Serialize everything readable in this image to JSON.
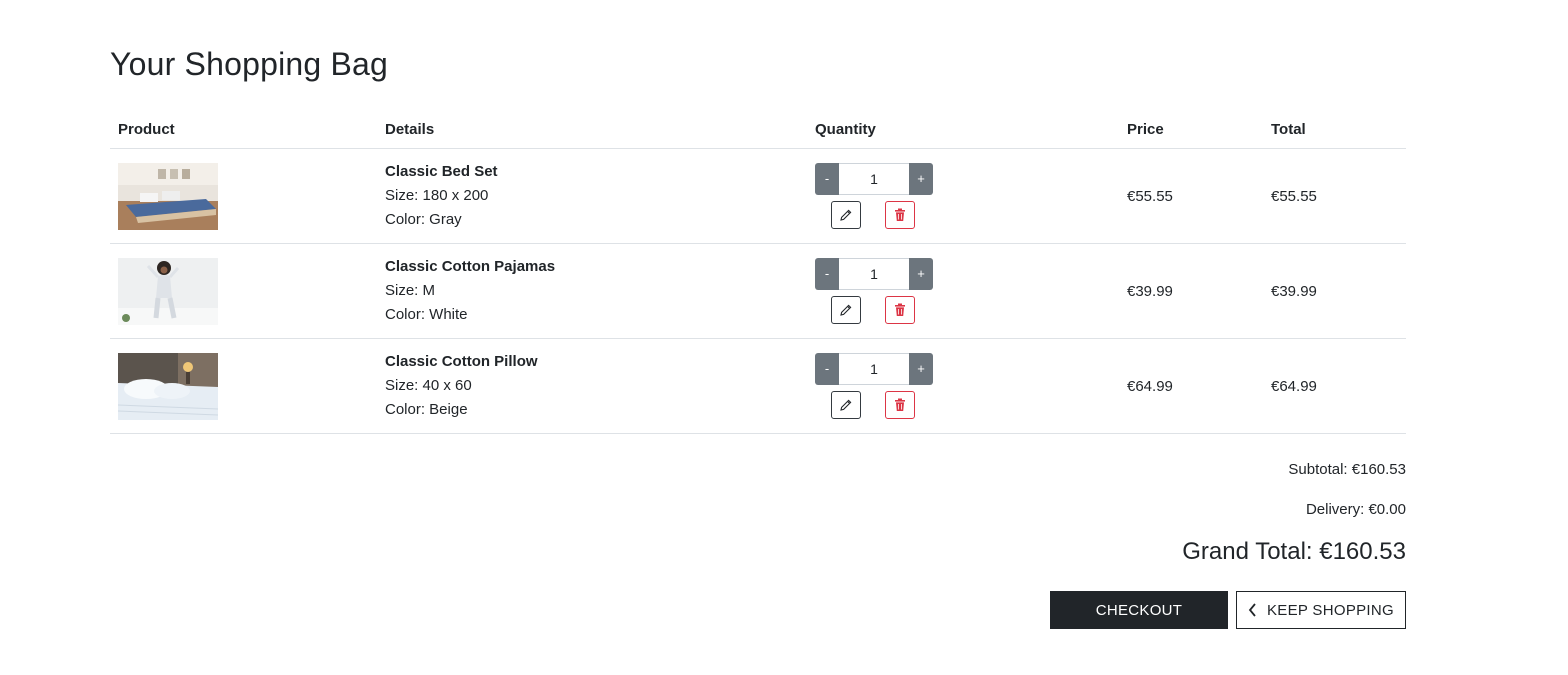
{
  "page": {
    "title": "Your Shopping Bag"
  },
  "table": {
    "headers": [
      "Product",
      "Details",
      "Quantity",
      "Price",
      "Total"
    ]
  },
  "items": [
    {
      "name": "Classic Bed Set",
      "size": "Size: 180 x 200",
      "color": "Color: Gray",
      "qty_minus": "-",
      "quantity": "1",
      "qty_plus": "+",
      "price": "€55.55",
      "total": "€55.55",
      "image_icon": "bed-set-photo"
    },
    {
      "name": "Classic Cotton Pajamas",
      "size": "Size: M",
      "color": "Color: White",
      "qty_minus": "-",
      "quantity": "1",
      "qty_plus": "+",
      "price": "€39.99",
      "total": "€39.99",
      "image_icon": "pajamas-photo"
    },
    {
      "name": "Classic Cotton Pillow",
      "size": "Size: 40 x 60",
      "color": "Color: Beige",
      "qty_minus": "-",
      "quantity": "1",
      "qty_plus": "+",
      "price": "€64.99",
      "total": "€64.99",
      "image_icon": "pillow-photo"
    }
  ],
  "summary": {
    "subtotal": "Subtotal: €160.53",
    "delivery": "Delivery: €0.00",
    "grand_total": "Grand Total: €160.53"
  },
  "buttons": {
    "checkout": "CHECKOUT",
    "keep_shopping": "KEEP SHOPPING"
  },
  "colors": {
    "qty_button": "#6c757d",
    "remove_accent": "#dc3545",
    "checkout_bg": "#212529"
  }
}
